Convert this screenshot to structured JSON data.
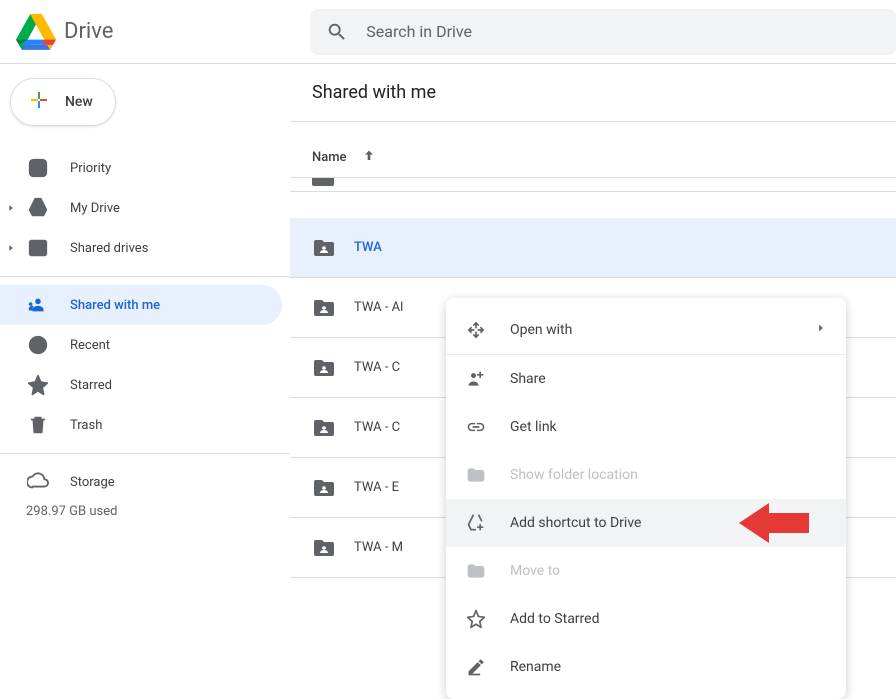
{
  "header": {
    "app_name": "Drive",
    "search_placeholder": "Search in Drive"
  },
  "sidebar": {
    "new_label": "New",
    "items": [
      {
        "label": "Priority"
      },
      {
        "label": "My Drive"
      },
      {
        "label": "Shared drives"
      },
      {
        "label": "Shared with me"
      },
      {
        "label": "Recent"
      },
      {
        "label": "Starred"
      },
      {
        "label": "Trash"
      }
    ],
    "storage_label": "Storage",
    "storage_used": "298.97 GB used"
  },
  "main": {
    "title": "Shared with me",
    "col_name": "Name",
    "files": [
      {
        "name": "TWA"
      },
      {
        "name": "TWA - Al"
      },
      {
        "name": "TWA - C"
      },
      {
        "name": "TWA - C"
      },
      {
        "name": "TWA - E"
      },
      {
        "name": "TWA - M"
      }
    ]
  },
  "ctx": {
    "open_with": "Open with",
    "share": "Share",
    "get_link": "Get link",
    "show_folder_location": "Show folder location",
    "add_shortcut": "Add shortcut to Drive",
    "move_to": "Move to",
    "add_to_starred": "Add to Starred",
    "rename": "Rename"
  }
}
